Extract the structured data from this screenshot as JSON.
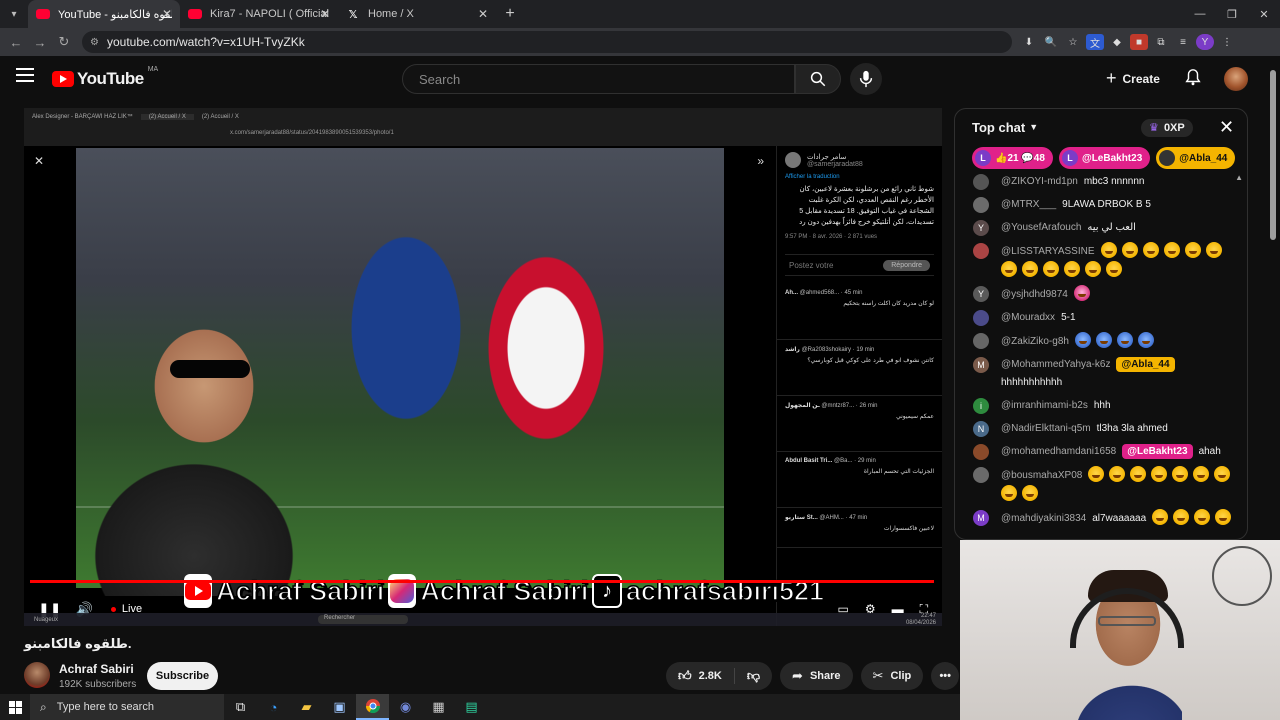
{
  "browser": {
    "tabs": [
      {
        "title": "YouTube - طلقوه فالكامبنو",
        "active": true,
        "favicon": "youtube-icon"
      },
      {
        "title": "Kira7 - NAPOLI ( Official Clip )",
        "active": false,
        "favicon": "youtube-icon"
      },
      {
        "title": "Home / X",
        "active": false,
        "favicon": "x-icon"
      }
    ],
    "url": "youtube.com/watch?v=x1UH-TvyZKk"
  },
  "header": {
    "logo_text": "YouTube",
    "country_code": "MA",
    "search_placeholder": "Search",
    "create_label": "Create"
  },
  "player": {
    "inner_tabs": [
      "Alex Designer - BARÇAWI HAZ LIK™",
      "(2) Accueil / X",
      "(2) Accueil / X"
    ],
    "inner_url": "x.com/samerjaradat88/status/2041983890051539353/photo/1",
    "tweet_author": "سامر جرادات",
    "tweet_handle": "@samerjaradat88",
    "tweet_translate": "Afficher la traduction",
    "tweet_text": "شوط ثاني رائع من برشلونة بعشرة لاعبين، كان الأخطر رغم النقص العددي، لكن الكرة غلبت الشجاعة في غياب التوفيق. 18 تسديدة مقابل 5 تسديدات، لكن أتلتيكو خرج فائزاً بهدفين دون رد",
    "tweet_meta": "9:57 PM · 8 avr. 2026 · 2 871 vues",
    "reply_placeholder": "Postez votre",
    "reply_button": "Répondre",
    "comments": [
      {
        "name": "Ah...",
        "handle": "@ahmed568...",
        "time": "45 min",
        "text": "لو كان مدريد كان اكلت راسنه بتحكيم"
      },
      {
        "name": "راشد",
        "handle": "@Ra2083shokairy",
        "time": "19 min",
        "text": "كانتن نشوف انو في طرد على كوكي قبل كوبارسي؟"
      },
      {
        "name": "ـن المجهول",
        "handle": "@mntzr87...",
        "time": "26 min",
        "text": "عمكم سيميوني"
      },
      {
        "name": "Abdul Basit Tri...",
        "handle": "@Ba...",
        "time": "29 min",
        "text": "الجزئيات التي تحسم المباراة"
      },
      {
        "name": "ستاربو St...",
        "handle": "@AHM...",
        "time": "47 min",
        "text": "لاعبين فاكسسوارات"
      }
    ],
    "socials_text": [
      "Achraf Sabiri",
      "Achraf Sabiri",
      "achrafsabiri521"
    ],
    "live_label": "Live",
    "taskbar_search": "Rechercher",
    "taskbar_clock": [
      "22:47",
      "08/04/2026"
    ],
    "weather": "Nuageux"
  },
  "video": {
    "title": "طلقوه فالكامبنو.",
    "channel_name": "Achraf Sabiri",
    "subscribers": "192K subscribers",
    "subscribe_label": "Subscribe",
    "likes": "2.8K",
    "share_label": "Share",
    "clip_label": "Clip"
  },
  "chat": {
    "header": "Top chat",
    "xp_label": "0XP",
    "ticker": [
      {
        "letter": "L",
        "label": "👍21 💬48",
        "style": "pink"
      },
      {
        "letter": "L",
        "label": "@LeBakht23",
        "style": "pink"
      },
      {
        "letter": "",
        "label": "@Abla_44",
        "style": "gold"
      }
    ],
    "messages": [
      {
        "author": "@ZIKOYI-md1pn",
        "text": "mbc3 nnnnnn",
        "avatar_color": "#555555",
        "letter": ""
      },
      {
        "author": "@MTRX___",
        "text": "9LAWA DRBOK B 5",
        "avatar_color": "#6b6b6b",
        "letter": ""
      },
      {
        "author": "@YousefArafouch",
        "text": "العب لي بيه",
        "avatar_color": "#5b4b4b",
        "letter": "Y"
      },
      {
        "author": "@LISSTARYASSINE",
        "text": "",
        "avatar_color": "#aa4444",
        "letter": "",
        "emojis": 12,
        "emoji_color": "yellow"
      },
      {
        "author": "@ysjhdhd9874",
        "text": "",
        "avatar_color": "#5a5a5a",
        "letter": "Y",
        "emojis": 1,
        "emoji_color": "pink"
      },
      {
        "author": "@Mouradxx",
        "text": "5-1",
        "avatar_color": "#4b4b8a",
        "letter": ""
      },
      {
        "author": "@ZakiZiko-g8h",
        "text": "",
        "avatar_color": "#666666",
        "letter": "",
        "emojis": 4,
        "emoji_color": "blue"
      },
      {
        "author": "@MohammedYahya-k6z",
        "mention": "@Abla_44",
        "mention_style": "gold",
        "text": "hhhhhhhhhhh",
        "avatar_color": "#7a5a4a",
        "letter": "M"
      },
      {
        "author": "@imranhimami-b2s",
        "text": "hhh",
        "avatar_color": "#2e8b3e",
        "letter": "i"
      },
      {
        "author": "@NadirElkttani-q5m",
        "text": "tl3ha 3la ahmed",
        "avatar_color": "#4a6a8a",
        "letter": "N"
      },
      {
        "author": "@mohamedhamdani1658",
        "mention": "@LeBakht23",
        "mention_style": "pink",
        "text": "ahah",
        "avatar_color": "#8a4a2a",
        "letter": ""
      },
      {
        "author": "@bousmahaXP08",
        "text": "",
        "avatar_color": "#6a6a6a",
        "letter": "",
        "emojis": 9,
        "emoji_color": "yellow"
      },
      {
        "author": "@mahdiyakini3834",
        "text": "al7waaaaaa",
        "avatar_color": "#7b3cc7",
        "letter": "M",
        "emojis": 4,
        "emoji_color": "yellow"
      }
    ]
  },
  "taskbar": {
    "search_placeholder": "Type here to search"
  }
}
